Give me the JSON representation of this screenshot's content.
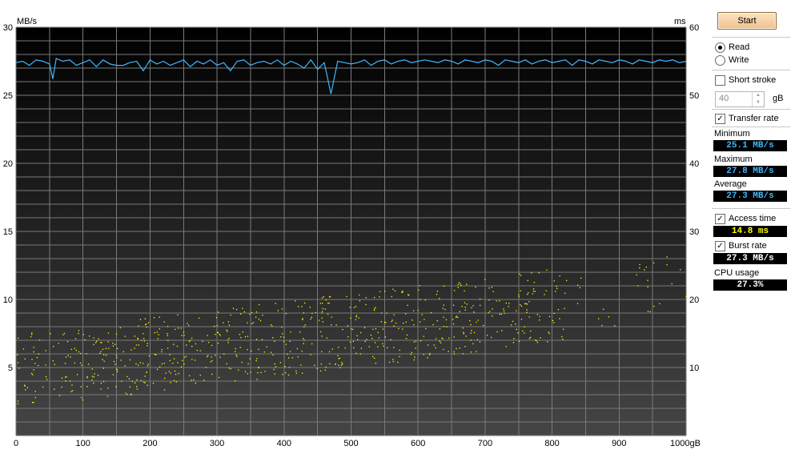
{
  "window": {
    "title": ""
  },
  "controls": {
    "start_label": "Start",
    "mode_read": "Read",
    "mode_write": "Write",
    "short_stroke_label": "Short stroke",
    "short_stroke_value": "40",
    "short_stroke_unit": "gB",
    "transfer_rate_label": "Transfer rate",
    "access_time_label": "Access time",
    "burst_rate_label": "Burst rate",
    "cpu_usage_label": "CPU usage"
  },
  "stats": {
    "minimum_label": "Minimum",
    "minimum_value": "25.1 MB/s",
    "maximum_label": "Maximum",
    "maximum_value": "27.8 MB/s",
    "average_label": "Average",
    "average_value": "27.3 MB/s",
    "access_time_value": "14.8 ms",
    "burst_rate_value": "27.3 MB/s",
    "cpu_usage_value": "27.3%"
  },
  "colors": {
    "plot_bg_top": "#000000",
    "plot_bg_bottom": "#454545",
    "grid": "#7a7a7a",
    "transfer_line": "#3fb7ff",
    "access_points": "#ffff00",
    "stat_blue": "#3fb7ff",
    "stat_yellow": "#ffff00",
    "stat_white": "#ffffff"
  },
  "chart_data": {
    "type": "line",
    "y_left_label": "MB/s",
    "y_right_label": "ms",
    "x_unit_label": "gB",
    "xlim": [
      0,
      1000
    ],
    "ylim_left": [
      0,
      30
    ],
    "ylim_right": [
      0,
      60
    ],
    "x_ticks": [
      "0",
      "100",
      "200",
      "300",
      "400",
      "500",
      "600",
      "700",
      "800",
      "900",
      "1000"
    ],
    "y_left_ticks": [
      "5",
      "10",
      "15",
      "20",
      "25",
      "30"
    ],
    "y_right_ticks": [
      "10",
      "20",
      "30",
      "40",
      "50",
      "60"
    ],
    "grid": true,
    "series": [
      {
        "axis": "left",
        "style": "line",
        "x": [
          0,
          10,
          20,
          30,
          40,
          50,
          55,
          60,
          70,
          80,
          90,
          100,
          110,
          120,
          130,
          140,
          150,
          160,
          170,
          180,
          190,
          200,
          210,
          220,
          230,
          240,
          250,
          260,
          270,
          280,
          290,
          300,
          310,
          320,
          330,
          340,
          350,
          360,
          370,
          380,
          390,
          400,
          410,
          420,
          430,
          440,
          450,
          460,
          470,
          480,
          490,
          500,
          510,
          520,
          530,
          540,
          550,
          560,
          570,
          580,
          590,
          600,
          610,
          620,
          630,
          640,
          650,
          660,
          670,
          680,
          690,
          700,
          710,
          720,
          730,
          740,
          750,
          760,
          770,
          780,
          790,
          800,
          810,
          820,
          830,
          840,
          850,
          860,
          870,
          880,
          890,
          900,
          910,
          920,
          930,
          940,
          950,
          960,
          970,
          980,
          990,
          1000
        ],
        "y": [
          27.4,
          27.5,
          27.2,
          27.6,
          27.5,
          27.3,
          26.2,
          27.7,
          27.5,
          27.6,
          27.2,
          27.4,
          27.6,
          27.1,
          27.6,
          27.3,
          27.2,
          27.2,
          27.4,
          27.5,
          26.8,
          27.6,
          27.3,
          27.5,
          27.2,
          27.4,
          27.6,
          27.1,
          27.5,
          27.3,
          27.6,
          27.2,
          27.4,
          26.8,
          27.5,
          27.6,
          27.2,
          27.4,
          27.5,
          27.3,
          27.6,
          27.2,
          27.5,
          27.3,
          27.0,
          27.6,
          26.9,
          27.4,
          25.1,
          27.5,
          27.4,
          27.3,
          27.4,
          27.6,
          27.2,
          27.5,
          27.6,
          27.3,
          27.5,
          27.6,
          27.4,
          27.5,
          27.6,
          27.5,
          27.4,
          27.6,
          27.5,
          27.3,
          27.6,
          27.5,
          27.4,
          27.6,
          27.5,
          27.2,
          27.6,
          27.5,
          27.4,
          27.6,
          27.3,
          27.5,
          27.6,
          27.4,
          27.5,
          27.6,
          27.2,
          27.6,
          27.5,
          27.3,
          27.6,
          27.5,
          27.4,
          27.6,
          27.5,
          27.3,
          27.6,
          27.5,
          27.4,
          27.6,
          27.5,
          27.6,
          27.4,
          27.5
        ]
      },
      {
        "axis": "right",
        "style": "scatter",
        "pattern": {
          "points": 900,
          "x_range": [
            0,
            1000
          ],
          "density_note": "points thin out after 820 gB",
          "y_ms_start_range": [
            4,
            15
          ],
          "y_ms_end_range": [
            16,
            27
          ]
        }
      }
    ]
  }
}
